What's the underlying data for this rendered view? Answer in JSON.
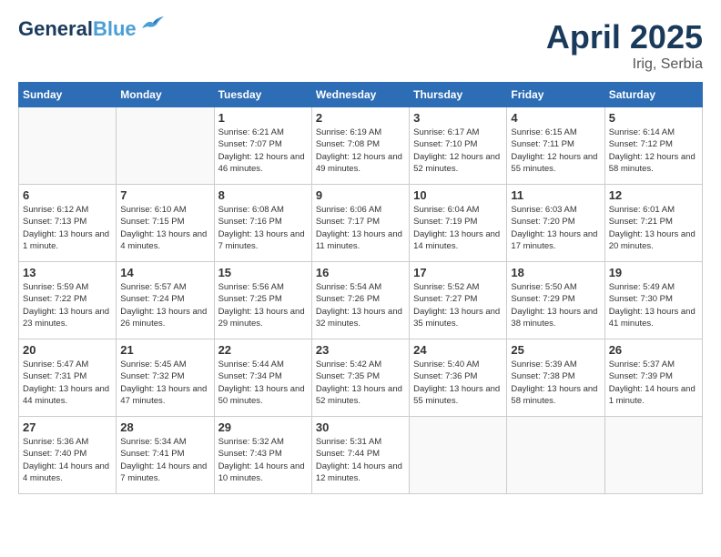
{
  "header": {
    "logo_line1": "General",
    "logo_line2": "Blue",
    "title": "April 2025",
    "subtitle": "Irig, Serbia"
  },
  "weekdays": [
    "Sunday",
    "Monday",
    "Tuesday",
    "Wednesday",
    "Thursday",
    "Friday",
    "Saturday"
  ],
  "weeks": [
    [
      {
        "day": "",
        "info": ""
      },
      {
        "day": "",
        "info": ""
      },
      {
        "day": "1",
        "info": "Sunrise: 6:21 AM\nSunset: 7:07 PM\nDaylight: 12 hours and 46 minutes."
      },
      {
        "day": "2",
        "info": "Sunrise: 6:19 AM\nSunset: 7:08 PM\nDaylight: 12 hours and 49 minutes."
      },
      {
        "day": "3",
        "info": "Sunrise: 6:17 AM\nSunset: 7:10 PM\nDaylight: 12 hours and 52 minutes."
      },
      {
        "day": "4",
        "info": "Sunrise: 6:15 AM\nSunset: 7:11 PM\nDaylight: 12 hours and 55 minutes."
      },
      {
        "day": "5",
        "info": "Sunrise: 6:14 AM\nSunset: 7:12 PM\nDaylight: 12 hours and 58 minutes."
      }
    ],
    [
      {
        "day": "6",
        "info": "Sunrise: 6:12 AM\nSunset: 7:13 PM\nDaylight: 13 hours and 1 minute."
      },
      {
        "day": "7",
        "info": "Sunrise: 6:10 AM\nSunset: 7:15 PM\nDaylight: 13 hours and 4 minutes."
      },
      {
        "day": "8",
        "info": "Sunrise: 6:08 AM\nSunset: 7:16 PM\nDaylight: 13 hours and 7 minutes."
      },
      {
        "day": "9",
        "info": "Sunrise: 6:06 AM\nSunset: 7:17 PM\nDaylight: 13 hours and 11 minutes."
      },
      {
        "day": "10",
        "info": "Sunrise: 6:04 AM\nSunset: 7:19 PM\nDaylight: 13 hours and 14 minutes."
      },
      {
        "day": "11",
        "info": "Sunrise: 6:03 AM\nSunset: 7:20 PM\nDaylight: 13 hours and 17 minutes."
      },
      {
        "day": "12",
        "info": "Sunrise: 6:01 AM\nSunset: 7:21 PM\nDaylight: 13 hours and 20 minutes."
      }
    ],
    [
      {
        "day": "13",
        "info": "Sunrise: 5:59 AM\nSunset: 7:22 PM\nDaylight: 13 hours and 23 minutes."
      },
      {
        "day": "14",
        "info": "Sunrise: 5:57 AM\nSunset: 7:24 PM\nDaylight: 13 hours and 26 minutes."
      },
      {
        "day": "15",
        "info": "Sunrise: 5:56 AM\nSunset: 7:25 PM\nDaylight: 13 hours and 29 minutes."
      },
      {
        "day": "16",
        "info": "Sunrise: 5:54 AM\nSunset: 7:26 PM\nDaylight: 13 hours and 32 minutes."
      },
      {
        "day": "17",
        "info": "Sunrise: 5:52 AM\nSunset: 7:27 PM\nDaylight: 13 hours and 35 minutes."
      },
      {
        "day": "18",
        "info": "Sunrise: 5:50 AM\nSunset: 7:29 PM\nDaylight: 13 hours and 38 minutes."
      },
      {
        "day": "19",
        "info": "Sunrise: 5:49 AM\nSunset: 7:30 PM\nDaylight: 13 hours and 41 minutes."
      }
    ],
    [
      {
        "day": "20",
        "info": "Sunrise: 5:47 AM\nSunset: 7:31 PM\nDaylight: 13 hours and 44 minutes."
      },
      {
        "day": "21",
        "info": "Sunrise: 5:45 AM\nSunset: 7:32 PM\nDaylight: 13 hours and 47 minutes."
      },
      {
        "day": "22",
        "info": "Sunrise: 5:44 AM\nSunset: 7:34 PM\nDaylight: 13 hours and 50 minutes."
      },
      {
        "day": "23",
        "info": "Sunrise: 5:42 AM\nSunset: 7:35 PM\nDaylight: 13 hours and 52 minutes."
      },
      {
        "day": "24",
        "info": "Sunrise: 5:40 AM\nSunset: 7:36 PM\nDaylight: 13 hours and 55 minutes."
      },
      {
        "day": "25",
        "info": "Sunrise: 5:39 AM\nSunset: 7:38 PM\nDaylight: 13 hours and 58 minutes."
      },
      {
        "day": "26",
        "info": "Sunrise: 5:37 AM\nSunset: 7:39 PM\nDaylight: 14 hours and 1 minute."
      }
    ],
    [
      {
        "day": "27",
        "info": "Sunrise: 5:36 AM\nSunset: 7:40 PM\nDaylight: 14 hours and 4 minutes."
      },
      {
        "day": "28",
        "info": "Sunrise: 5:34 AM\nSunset: 7:41 PM\nDaylight: 14 hours and 7 minutes."
      },
      {
        "day": "29",
        "info": "Sunrise: 5:32 AM\nSunset: 7:43 PM\nDaylight: 14 hours and 10 minutes."
      },
      {
        "day": "30",
        "info": "Sunrise: 5:31 AM\nSunset: 7:44 PM\nDaylight: 14 hours and 12 minutes."
      },
      {
        "day": "",
        "info": ""
      },
      {
        "day": "",
        "info": ""
      },
      {
        "day": "",
        "info": ""
      }
    ]
  ]
}
